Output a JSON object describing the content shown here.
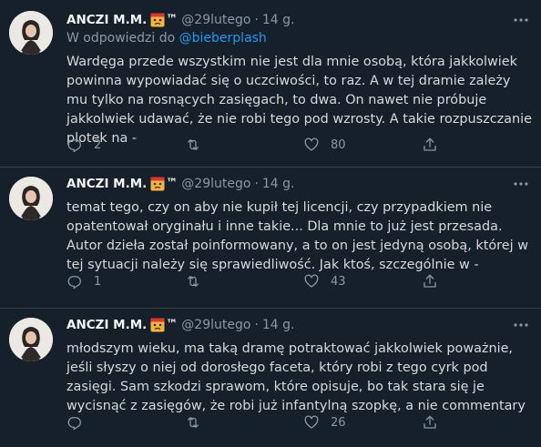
{
  "colors": {
    "background": "#15202b",
    "text": "#d9d9d9",
    "secondary": "#8b98a5",
    "link": "#1d9bf0",
    "divider": "#38444d"
  },
  "tweets": [
    {
      "name": "ANCZI M.M.",
      "badge": "™",
      "handle": "@29lutego",
      "separator": "·",
      "time": "14 g.",
      "reply_prefix": "W odpowiedzi do",
      "reply_to": "@bieberplash",
      "text": "Wardęga przede wszystkim nie jest dla mnie osobą, która jakkolwiek powinna wypowiadać się o uczciwości, to raz. A w tej dramie zależy mu tylko na rosnących zasięgach, to dwa. On nawet nie próbuje jakkolwiek udawać, że nie robi tego pod wzrosty. A takie rozpuszczanie plotek na -",
      "replies": "2",
      "retweets": "",
      "likes": "80"
    },
    {
      "name": "ANCZI M.M.",
      "badge": "™",
      "handle": "@29lutego",
      "separator": "·",
      "time": "14 g.",
      "text": "temat tego, czy on aby nie kupił tej licencji, czy przypadkiem nie opatentował oryginału i inne takie... Dla mnie to już jest przesada. Autor dzieła został poinformowany, a to on jest jedyną osobą, której w tej sytuacji należy się sprawiedliwość. Jak ktoś, szczególnie w -",
      "replies": "1",
      "retweets": "",
      "likes": "43"
    },
    {
      "name": "ANCZI M.M.",
      "badge": "™",
      "handle": "@29lutego",
      "separator": "·",
      "time": "14 g.",
      "text": "młodszym wieku, ma taką dramę potraktować jakkolwiek poważnie, jeśli słyszy o niej od dorosłego faceta, który robi z tego cyrk pod zasięgi. Sam szkodzi sprawom, które opisuje, bo tak stara się je wycisnąć z zasięgów, że robi już infantylną szopkę, a nie commentary",
      "replies": "",
      "retweets": "",
      "likes": "26"
    }
  ],
  "icons": {
    "emoji": "worried-face-emoji-icon",
    "more": "more-dots-icon",
    "reply": "reply-icon",
    "retweet": "retweet-icon",
    "like": "heart-icon",
    "share": "share-icon"
  }
}
